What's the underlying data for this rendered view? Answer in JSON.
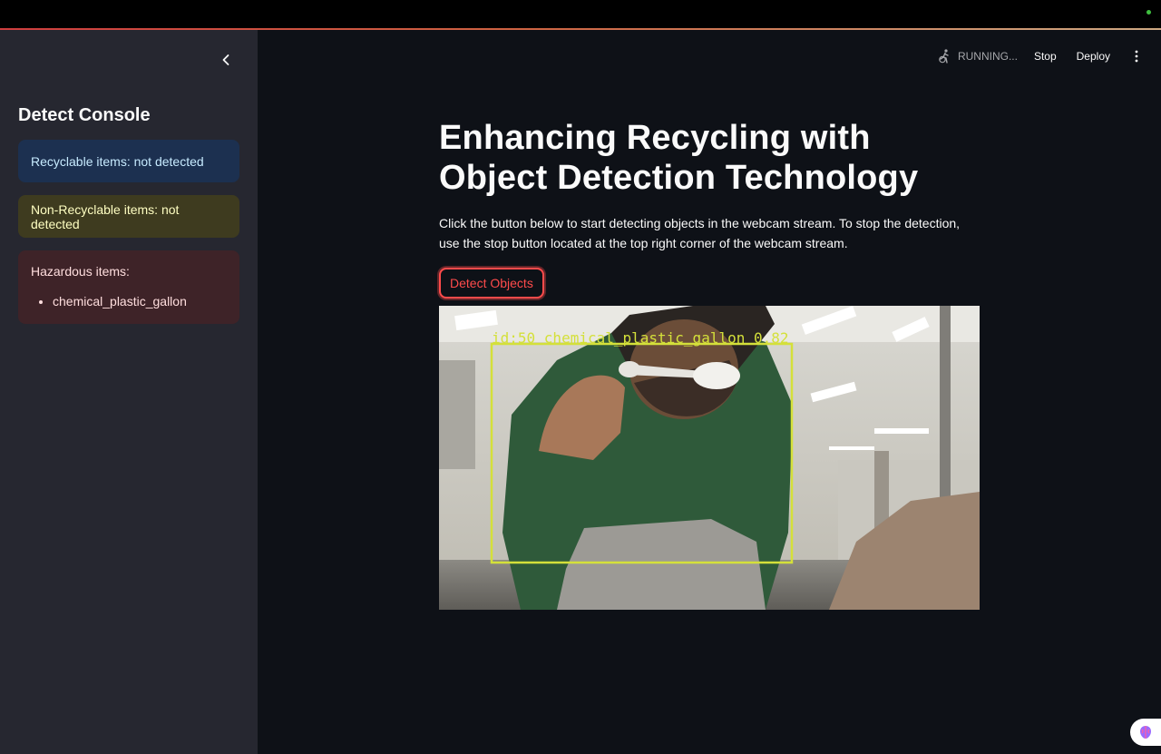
{
  "sidebar": {
    "title": "Detect Console",
    "recyclable": "Recyclable items: not detected",
    "non_recyclable": "Non-Recyclable items: not detected",
    "hazardous_label": "Hazardous items:",
    "hazardous_items": [
      "chemical_plastic_gallon"
    ]
  },
  "toolbar": {
    "status": "RUNNING...",
    "stop": "Stop",
    "deploy": "Deploy"
  },
  "main": {
    "title": "Enhancing Recycling with Object Detection Technology",
    "description": "Click the button below to start detecting objects in the webcam stream. To stop the detection, use the stop button located at the top right corner of the webcam stream.",
    "detect_button": "Detect Objects"
  },
  "webcam": {
    "detection_label": "id:50 chemical_plastic_gallon 0.82"
  },
  "colors": {
    "accent": "#ff4b4b",
    "background": "#0e1117",
    "sidebar": "#262730",
    "bbox": "#d4e03a"
  }
}
